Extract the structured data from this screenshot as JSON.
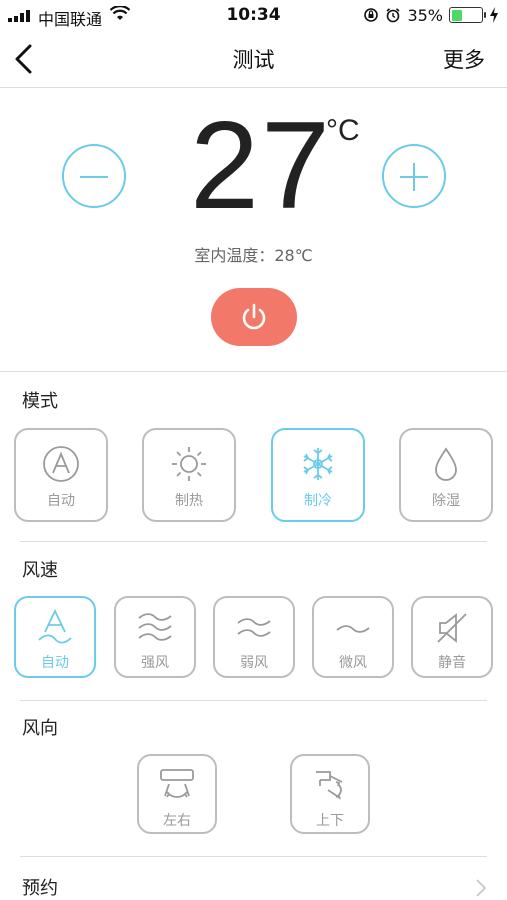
{
  "status_bar": {
    "carrier": "中国联通",
    "time": "10:34",
    "battery_percent": "35%",
    "battery_level": 0.35
  },
  "nav": {
    "title": "测试",
    "more_label": "更多"
  },
  "temperature": {
    "value": "27",
    "unit": "°C",
    "indoor_text": "室内温度：28℃"
  },
  "mode": {
    "title": "模式",
    "items": [
      {
        "label": "自动",
        "icon": "auto-a-circle-icon",
        "active": false
      },
      {
        "label": "制热",
        "icon": "sun-icon",
        "active": false
      },
      {
        "label": "制冷",
        "icon": "snowflake-icon",
        "active": true
      },
      {
        "label": "除湿",
        "icon": "droplet-icon",
        "active": false
      }
    ]
  },
  "fan": {
    "title": "风速",
    "items": [
      {
        "label": "自动",
        "icon": "auto-wind-icon",
        "active": true
      },
      {
        "label": "强风",
        "icon": "wind-strong-icon",
        "active": false
      },
      {
        "label": "弱风",
        "icon": "wind-weak-icon",
        "active": false
      },
      {
        "label": "微风",
        "icon": "wind-breeze-icon",
        "active": false
      },
      {
        "label": "静音",
        "icon": "mute-icon",
        "active": false
      }
    ]
  },
  "direction": {
    "title": "风向",
    "items": [
      {
        "label": "左右",
        "icon": "swing-horizontal-icon",
        "active": false
      },
      {
        "label": "上下",
        "icon": "swing-vertical-icon",
        "active": false
      }
    ]
  },
  "schedule": {
    "label": "预约"
  },
  "colors": {
    "accent": "#6ccbe8",
    "power": "#f2786a",
    "inactive": "#bdbdbd",
    "battery": "#4cd964"
  }
}
